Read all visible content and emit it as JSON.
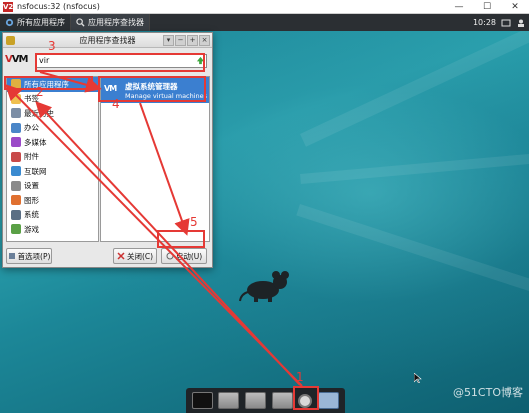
{
  "window": {
    "title": "nsfocus:32 (nsfocus)",
    "icon_label": "V2",
    "controls": [
      "—",
      "☐",
      "✕"
    ]
  },
  "top_panel": {
    "menu_button": "所有应用程序",
    "task_button": "应用程序查找器",
    "clock": "10:28"
  },
  "finder": {
    "title": "应用程序查找器",
    "logo": "VM",
    "search_value": "vir",
    "categories": [
      {
        "label": "所有应用程序",
        "color": "#e0b040",
        "selected": true
      },
      {
        "label": "书签",
        "color": "#f0c050",
        "selected": false
      },
      {
        "label": "最近历史",
        "color": "#7c8ea6",
        "selected": false
      },
      {
        "label": "办公",
        "color": "#4a86c8",
        "selected": false
      },
      {
        "label": "多媒体",
        "color": "#9b4ac8",
        "selected": false
      },
      {
        "label": "附件",
        "color": "#c84a4a",
        "selected": false
      },
      {
        "label": "互联网",
        "color": "#3a8ad0",
        "selected": false
      },
      {
        "label": "设置",
        "color": "#8a8a8a",
        "selected": false
      },
      {
        "label": "图形",
        "color": "#e07030",
        "selected": false
      },
      {
        "label": "系统",
        "color": "#5a6e84",
        "selected": false
      },
      {
        "label": "游戏",
        "color": "#5aa046",
        "selected": false
      }
    ],
    "result": {
      "icon": "VM",
      "name": "虚拟系统管理器",
      "description": "Manage virtual machines"
    },
    "buttons": {
      "preferences": "首选项(P)",
      "close": "关闭(C)",
      "launch": "启动(U)"
    }
  },
  "annotations": {
    "step1": "1",
    "step2": "2",
    "step3": "3",
    "step4": "4",
    "step5": "5"
  },
  "watermark": "@51CTO博客",
  "colors": {
    "annotation": "#e53935",
    "selection": "#3b7fd0",
    "panel": "#2b2f33"
  },
  "icons": {
    "vnc": "vnc-logo-icon",
    "search_go": "arrow-up-icon",
    "dock": [
      "terminal-icon",
      "workspace-1-icon",
      "workspace-2-icon",
      "workspace-3-icon",
      "app-finder-icon",
      "folder-icon"
    ]
  }
}
